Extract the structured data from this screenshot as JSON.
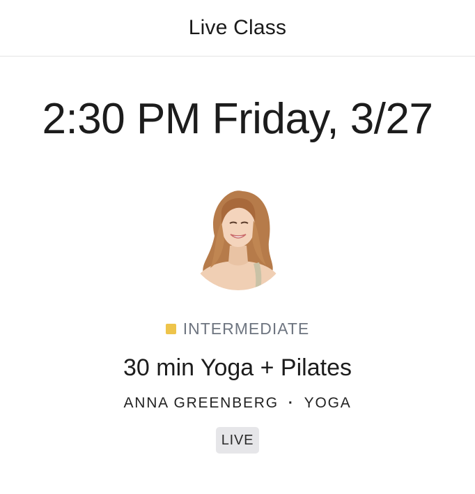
{
  "header": {
    "title": "Live Class"
  },
  "schedule": {
    "datetime": "2:30 PM Friday, 3/27"
  },
  "instructor": {
    "avatar_icon": "instructor-photo",
    "name": "ANNA GREENBERG"
  },
  "class": {
    "level": "INTERMEDIATE",
    "level_color": "#EEC44B",
    "title": "30 min Yoga + Pilates",
    "category": "YOGA",
    "separator": "·",
    "status_badge": "LIVE"
  }
}
